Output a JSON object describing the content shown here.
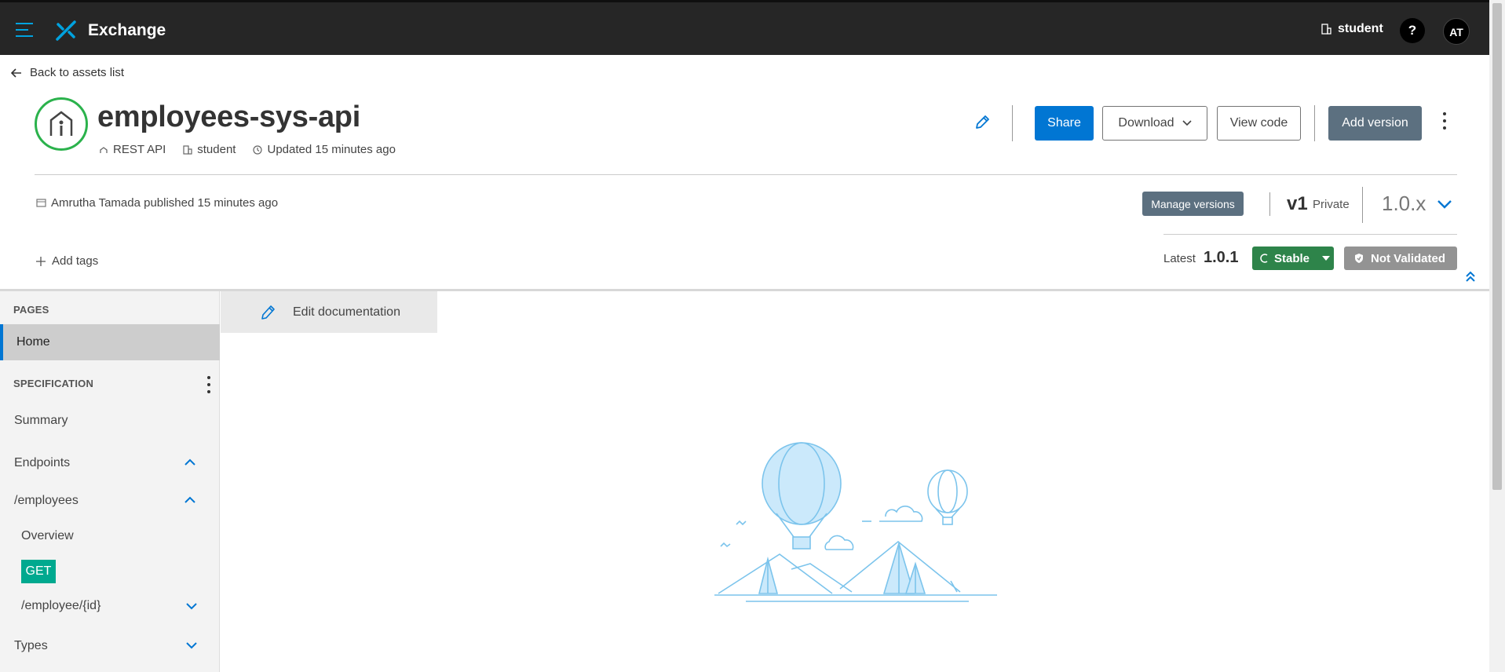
{
  "topbar": {
    "app_title": "Exchange",
    "org_name": "student",
    "help_label": "?",
    "avatar_initials": "AT"
  },
  "header": {
    "back_label": "Back to assets list",
    "asset_title": "employees-sys-api",
    "asset_type": "REST API",
    "asset_org": "student",
    "updated": "Updated 15 minutes ago",
    "buttons": {
      "share": "Share",
      "download": "Download",
      "view_code": "View code",
      "add_version": "Add version"
    },
    "published": "Amrutha Tamada published 15 minutes ago",
    "manage_versions": "Manage versions",
    "version_major": "v1",
    "version_visibility": "Private",
    "version_select": "1.0.x",
    "add_tags": "Add tags",
    "latest_label": "Latest",
    "latest_value": "1.0.1",
    "stable_label": "Stable",
    "not_validated_label": "Not Validated"
  },
  "sidebar": {
    "pages_title": "PAGES",
    "home": "Home",
    "spec_title": "SPECIFICATION",
    "summary": "Summary",
    "endpoints": "Endpoints",
    "employees_path": "/employees",
    "overview": "Overview",
    "get_method": "GET",
    "employee_id_path": "/employee/{id}",
    "types": "Types"
  },
  "content": {
    "edit_documentation": "Edit documentation"
  },
  "colors": {
    "topbar_bg": "#262626",
    "brand_blue": "#0176d3",
    "accent_blue": "#00a2df",
    "stable_green": "#2e844a",
    "get_teal": "#00a98f"
  }
}
